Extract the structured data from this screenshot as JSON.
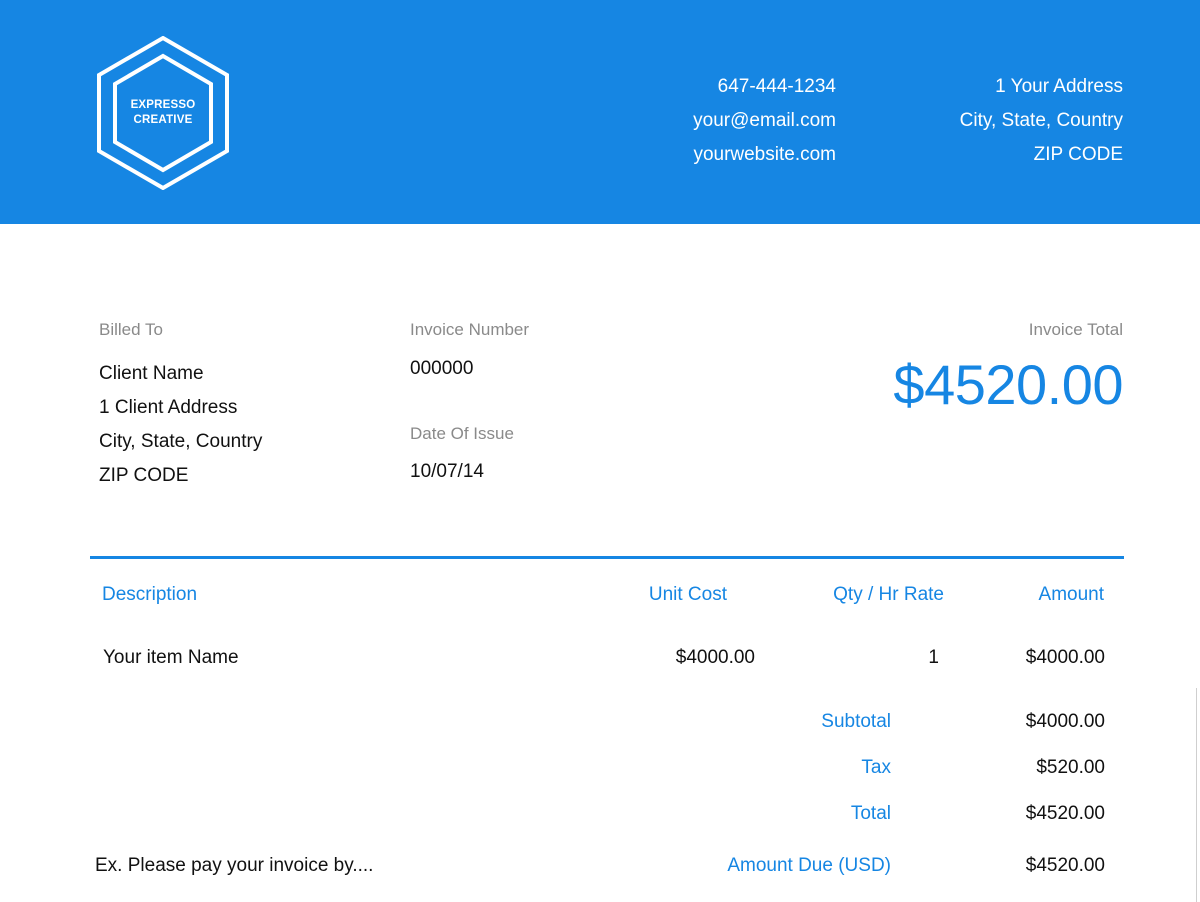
{
  "brand": {
    "logo_line1": "EXPRESSO",
    "logo_line2": "CREATIVE",
    "accent_color": "#1686e3"
  },
  "contact": {
    "phone": "647-444-1234",
    "email": "your@email.com",
    "website": "yourwebsite.com"
  },
  "sender_address": {
    "line1": "1 Your Address",
    "line2": "City, State, Country",
    "line3": "ZIP CODE"
  },
  "billed_to": {
    "label": "Billed To",
    "name": "Client Name",
    "address": "1 Client Address",
    "city": "City, State, Country",
    "zip": "ZIP CODE"
  },
  "invoice": {
    "number_label": "Invoice Number",
    "number": "000000",
    "date_label": "Date Of Issue",
    "date": "10/07/14",
    "total_label": "Invoice Total",
    "total": "$4520.00"
  },
  "table": {
    "headers": {
      "description": "Description",
      "unit_cost": "Unit Cost",
      "qty": "Qty / Hr Rate",
      "amount": "Amount"
    },
    "rows": [
      {
        "description": "Your item Name",
        "unit_cost": "$4000.00",
        "qty": "1",
        "amount": "$4000.00"
      }
    ]
  },
  "summary": {
    "subtotal_label": "Subtotal",
    "subtotal": "$4000.00",
    "tax_label": "Tax",
    "tax": "$520.00",
    "total_label": "Total",
    "total": "$4520.00",
    "amount_due_label": "Amount Due (USD)",
    "amount_due": "$4520.00"
  },
  "note": "Ex. Please pay your invoice by...."
}
